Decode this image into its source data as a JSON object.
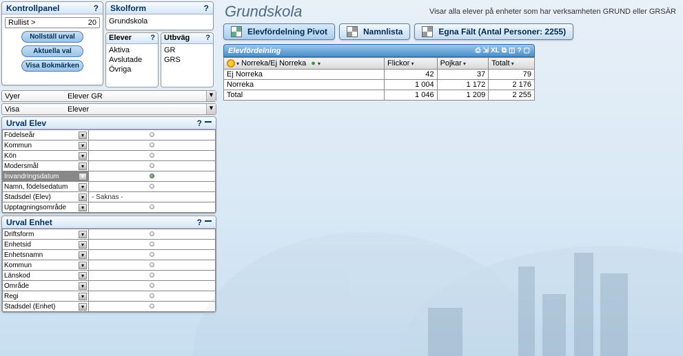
{
  "kontrollpanel": {
    "title": "Kontrollpanel",
    "rullist_label": "Rullist >",
    "rullist_value": "20",
    "buttons": {
      "nollstall": "Nollställ urval",
      "aktuella": "Aktuella val",
      "bokmarken": "Visa Bokmärken"
    }
  },
  "skolform": {
    "title": "Skolform",
    "value": "Grundskola"
  },
  "elever": {
    "title": "Elever",
    "items": [
      "Aktiva",
      "Avslutade",
      "Övriga"
    ]
  },
  "utbvag": {
    "title": "Utbväg",
    "items": [
      "GR",
      "GRS"
    ]
  },
  "vyer": {
    "label": "Vyer",
    "value": "Elever GR"
  },
  "visa": {
    "label": "Visa",
    "value": "Elever"
  },
  "urval_elev": {
    "title": "Urval Elev",
    "rows": [
      {
        "name": "Födelseår",
        "sel": false,
        "val": ""
      },
      {
        "name": "Kommun",
        "sel": false,
        "val": ""
      },
      {
        "name": "Kön",
        "sel": false,
        "val": ""
      },
      {
        "name": "Modersmål",
        "sel": false,
        "val": ""
      },
      {
        "name": "Invandringsdatum",
        "sel": true,
        "val": ""
      },
      {
        "name": "Namn, födelsedatum",
        "sel": false,
        "val": ""
      },
      {
        "name": "Stadsdel (Elev)",
        "sel": false,
        "val": "- Saknas -"
      },
      {
        "name": "Upptagningsområde",
        "sel": false,
        "val": ""
      }
    ]
  },
  "urval_enhet": {
    "title": "Urval Enhet",
    "rows": [
      {
        "name": "Driftsform"
      },
      {
        "name": "Enhetsid"
      },
      {
        "name": "Enhetsnamn"
      },
      {
        "name": "Kommun"
      },
      {
        "name": "Länskod"
      },
      {
        "name": "Område"
      },
      {
        "name": "Regi"
      },
      {
        "name": "Stadsdel (Enhet)"
      }
    ]
  },
  "page": {
    "title": "Grundskola",
    "subtitle": "Visar alla elever på enheter som har verksamheten GRUND eller GRSÄR"
  },
  "tabs": {
    "pivot": "Elevfördelning Pivot",
    "namnlista": "Namnlista",
    "egna": "Egna Fält (Antal Personer: 2255)"
  },
  "chart_data": {
    "type": "table",
    "title": "Elevfördelning",
    "dimension": "Norreka/Ej Norreka",
    "columns": [
      "Flickor",
      "Pojkar",
      "Totalt"
    ],
    "rows": [
      {
        "label": "Ej Norreka",
        "values": [
          "42",
          "37",
          "79"
        ]
      },
      {
        "label": "Norreka",
        "values": [
          "1 004",
          "1 172",
          "2 176"
        ]
      },
      {
        "label": "Total",
        "values": [
          "1 046",
          "1 209",
          "2 255"
        ]
      }
    ],
    "toolbar": [
      "XL"
    ]
  }
}
